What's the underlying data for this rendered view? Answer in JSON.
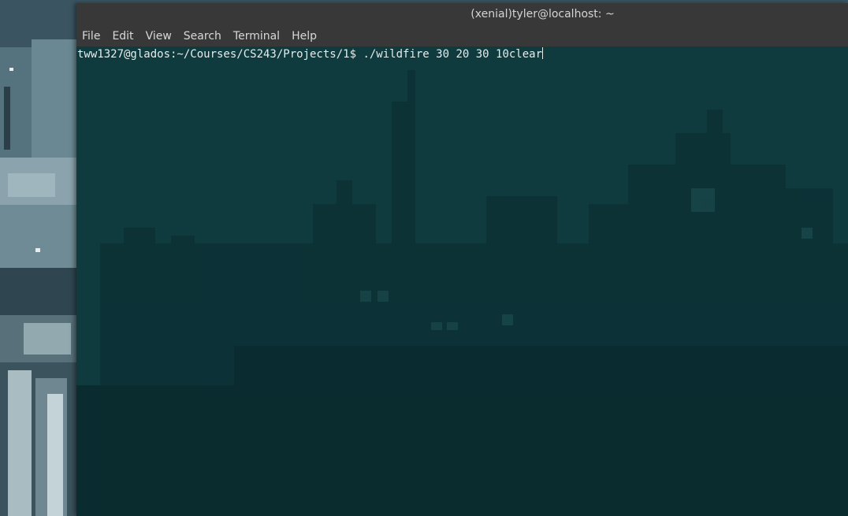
{
  "window": {
    "title": "(xenial)tyler@localhost: ~"
  },
  "menubar": {
    "items": [
      "File",
      "Edit",
      "View",
      "Search",
      "Terminal",
      "Help"
    ]
  },
  "terminal": {
    "prompt": "tww1327@glados:~/Courses/CS243/Projects/1$",
    "command": " ./wildfire 30 20 30 10clear"
  },
  "colors": {
    "titlebar": "#383838",
    "terminal_background": "#0f3a3e",
    "text": "#e6ecec"
  }
}
